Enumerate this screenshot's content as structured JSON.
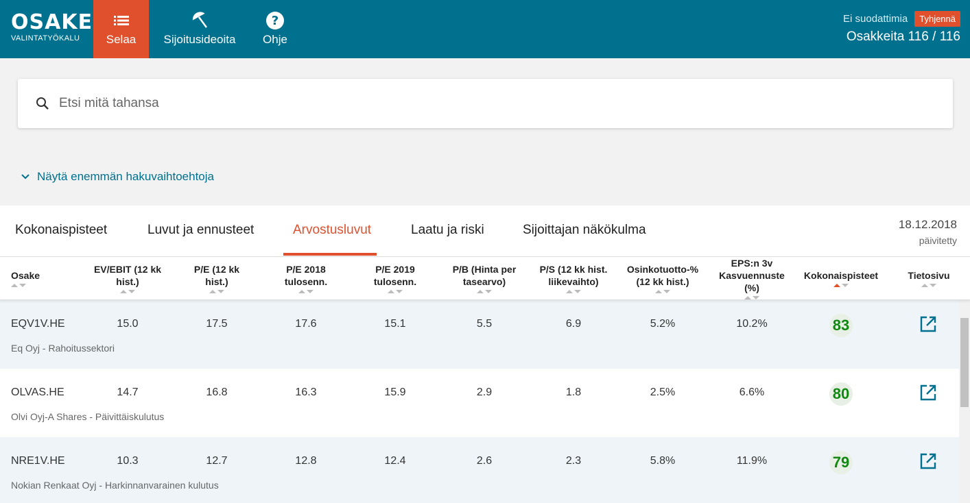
{
  "header": {
    "logo_main": "OSAKE",
    "logo_sub": "VALINTATYÖKALU",
    "nav": [
      {
        "label": "Selaa",
        "icon": "list-icon",
        "active": true
      },
      {
        "label": "Sijoitusideoita",
        "icon": "umbrella-icon",
        "active": false
      },
      {
        "label": "Ohje",
        "icon": "help-icon",
        "active": false
      }
    ],
    "filter_status": "Ei suodattimia",
    "clear_label": "Tyhjennä",
    "stock_count": "Osakkeita 116 / 116"
  },
  "search": {
    "placeholder": "Etsi mitä tahansa",
    "value": ""
  },
  "more_options_label": "Näytä enemmän hakuvaihtoehtoja",
  "tabs": [
    {
      "label": "Kokonaispisteet",
      "active": false
    },
    {
      "label": "Luvut ja ennusteet",
      "active": false
    },
    {
      "label": "Arvostusluvut",
      "active": true
    },
    {
      "label": "Laatu ja riski",
      "active": false
    },
    {
      "label": "Sijoittajan näkökulma",
      "active": false
    }
  ],
  "updated": {
    "date": "18.12.2018",
    "label": "päivitetty"
  },
  "columns": [
    {
      "label": "Osake"
    },
    {
      "label": "EV/EBIT (12 kk hist.)"
    },
    {
      "label": "P/E (12 kk hist.)"
    },
    {
      "label": "P/E 2018 tulosenn."
    },
    {
      "label": "P/E 2019 tulosenn."
    },
    {
      "label": "P/B (Hinta per tasearvo)"
    },
    {
      "label": "P/S (12 kk hist. liikevaihto)"
    },
    {
      "label": "Osinkotuotto-% (12 kk hist.)"
    },
    {
      "label": "EPS:n 3v Kasvuennuste (%)"
    },
    {
      "label": "Kokonaispisteet"
    },
    {
      "label": "Tietosivu"
    }
  ],
  "rows": [
    {
      "ticker": "EQV1V.HE",
      "company": "Eq Oyj - Rahoitussektori",
      "ev_ebit": "15.0",
      "pe_hist": "17.5",
      "pe_2018": "17.6",
      "pe_2019": "15.1",
      "pb": "5.5",
      "ps": "6.9",
      "div_yield": "5.2%",
      "eps_growth": "10.2%",
      "score": "83"
    },
    {
      "ticker": "OLVAS.HE",
      "company": "Olvi Oyj-A Shares - Päivittäiskulutus",
      "ev_ebit": "14.7",
      "pe_hist": "16.8",
      "pe_2018": "16.3",
      "pe_2019": "15.9",
      "pb": "2.9",
      "ps": "1.8",
      "div_yield": "2.5%",
      "eps_growth": "6.6%",
      "score": "80"
    },
    {
      "ticker": "NRE1V.HE",
      "company": "Nokian Renkaat Oyj - Harkinnanvarainen kulutus",
      "ev_ebit": "10.3",
      "pe_hist": "12.7",
      "pe_2018": "12.8",
      "pe_2019": "12.4",
      "pb": "2.6",
      "ps": "2.3",
      "div_yield": "5.8%",
      "eps_growth": "11.9%",
      "score": "79"
    }
  ],
  "colors": {
    "header_bg": "#00708f",
    "accent": "#e0502d",
    "score_green": "#118811"
  }
}
